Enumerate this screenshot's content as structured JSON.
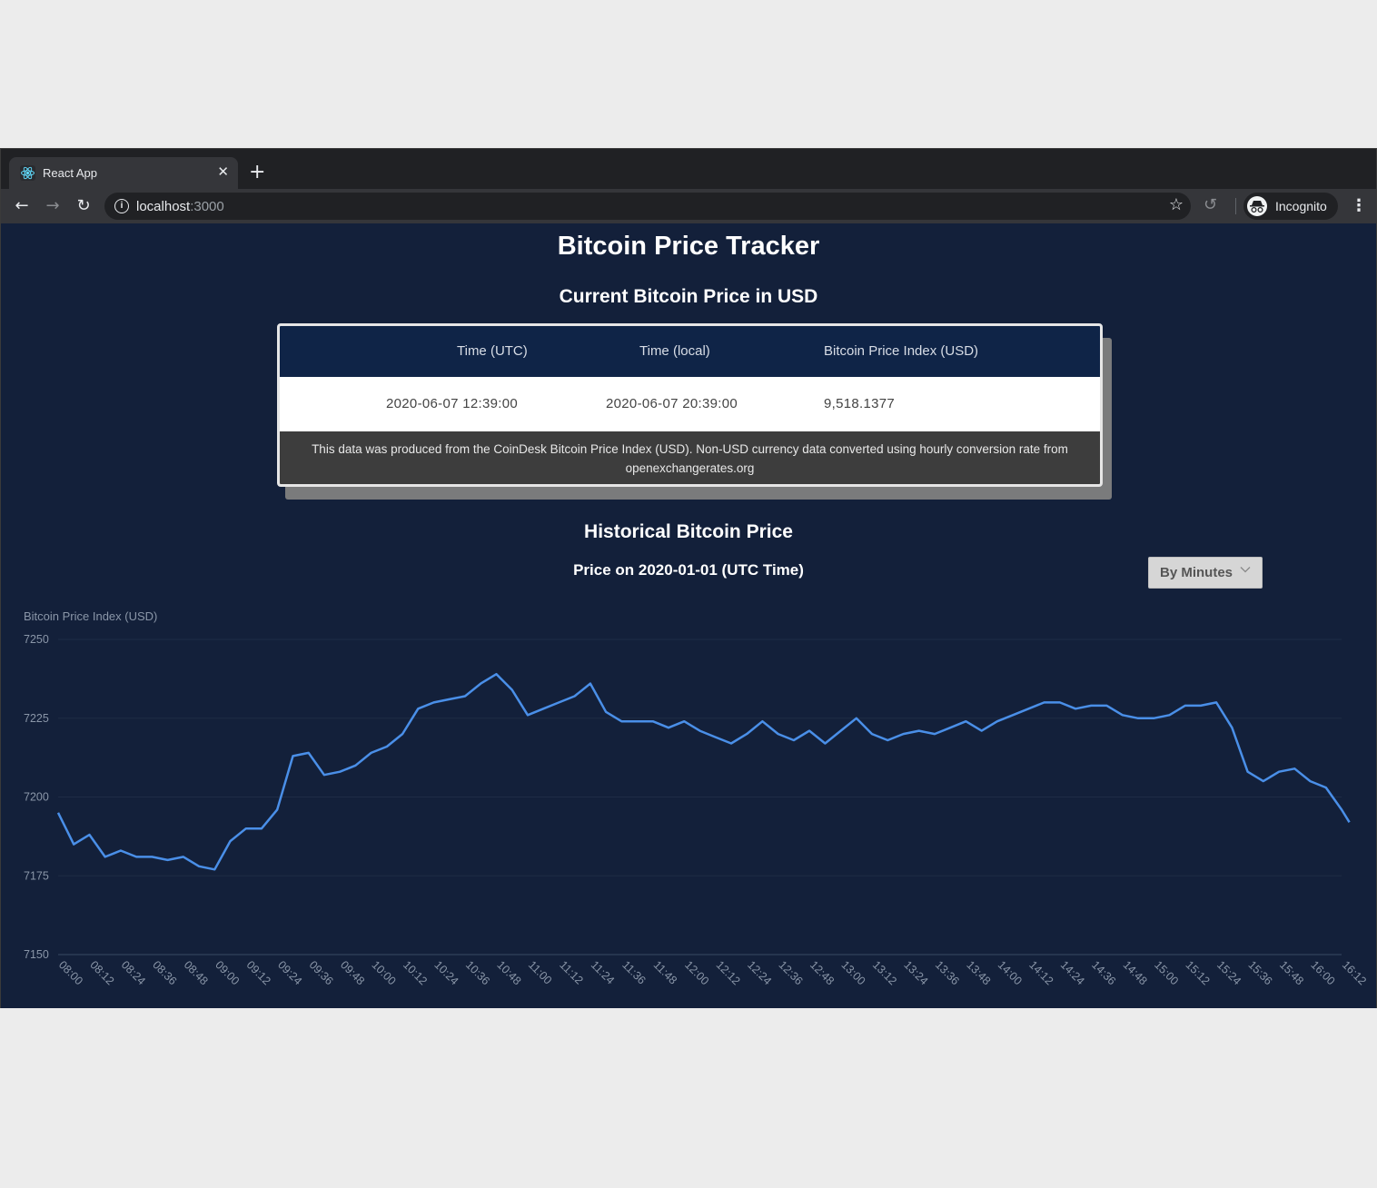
{
  "browser": {
    "tab_title": "React App",
    "url_host": "localhost",
    "url_port": ":3000",
    "profile_label": "Incognito",
    "icons": [
      "react-favicon",
      "close-icon",
      "plus-icon",
      "back-arrow-icon",
      "forward-arrow-icon",
      "reload-icon",
      "info-icon",
      "star-icon",
      "history-icon",
      "incognito-icon",
      "more-vert-icon"
    ]
  },
  "page": {
    "title": "Bitcoin Price Tracker",
    "current_section_title": "Current Bitcoin Price in USD",
    "table": {
      "headers": [
        "Time (UTC)",
        "Time (local)",
        "Bitcoin Price Index (USD)"
      ],
      "row": [
        "2020-06-07 12:39:00",
        "2020-06-07 20:39:00",
        "9,518.1377"
      ],
      "disclaimer": "This data was produced from the CoinDesk Bitcoin Price Index (USD). Non-USD currency data converted using hourly conversion rate from openexchangerates.org"
    },
    "historical_title": "Historical Bitcoin Price",
    "historical_subtitle": "Price on 2020-01-01 (UTC Time)",
    "granularity_select": {
      "selected": "By Minutes"
    }
  },
  "colors": {
    "background": "#13203a",
    "header": "#0f2447",
    "line": "#4a8fe8",
    "grid": "#1e2c45",
    "axis_text": "#8a96a8"
  },
  "chart_data": {
    "type": "line",
    "ylabel": "Bitcoin Price Index (USD)",
    "ylim": [
      7150,
      7250
    ],
    "yticks": [
      7150,
      7175,
      7200,
      7225,
      7250
    ],
    "xtick_labels": [
      "08:00",
      "08:12",
      "08:24",
      "08:36",
      "08:48",
      "09:00",
      "09:12",
      "09:24",
      "09:36",
      "09:48",
      "10:00",
      "10:12",
      "10:24",
      "10:36",
      "10:48",
      "11:00",
      "11:12",
      "11:24",
      "11:36",
      "11:48",
      "12:00",
      "12:12",
      "12:24",
      "12:36",
      "12:48",
      "13:00",
      "13:12",
      "13:24",
      "13:36",
      "13:48",
      "14:00",
      "14:12",
      "14:24",
      "14:36",
      "14:48",
      "15:00",
      "15:12",
      "15:24",
      "15:36",
      "15:48",
      "16:00",
      "16:12"
    ],
    "grid": "horizontal",
    "series": [
      {
        "x": [
          "08:00",
          "08:06",
          "08:12",
          "08:18",
          "08:24",
          "08:30",
          "08:36",
          "08:42",
          "08:48",
          "08:54",
          "09:00",
          "09:06",
          "09:12",
          "09:18",
          "09:24",
          "09:30",
          "09:36",
          "09:42",
          "09:48",
          "09:54",
          "10:00",
          "10:06",
          "10:12",
          "10:18",
          "10:24",
          "10:30",
          "10:36",
          "10:42",
          "10:48",
          "10:54",
          "11:00",
          "11:06",
          "11:12",
          "11:18",
          "11:24",
          "11:30",
          "11:36",
          "11:42",
          "11:48",
          "11:54",
          "12:00",
          "12:06",
          "12:12",
          "12:18",
          "12:24",
          "12:30",
          "12:36",
          "12:42",
          "12:48",
          "12:54",
          "13:00",
          "13:06",
          "13:12",
          "13:18",
          "13:24",
          "13:30",
          "13:36",
          "13:42",
          "13:48",
          "13:54",
          "14:00",
          "14:06",
          "14:12",
          "14:18",
          "14:24",
          "14:30",
          "14:36",
          "14:42",
          "14:48",
          "14:54",
          "15:00",
          "15:06",
          "15:12",
          "15:18",
          "15:24",
          "15:30",
          "15:36",
          "15:42",
          "15:48",
          "15:54",
          "16:00",
          "16:06",
          "16:12",
          "16:15"
        ],
        "values": [
          7195,
          7185,
          7188,
          7181,
          7183,
          7181,
          7181,
          7180,
          7181,
          7178,
          7177,
          7186,
          7190,
          7190,
          7196,
          7213,
          7214,
          7207,
          7208,
          7210,
          7214,
          7216,
          7220,
          7228,
          7230,
          7231,
          7232,
          7236,
          7239,
          7234,
          7226,
          7228,
          7230,
          7232,
          7236,
          7227,
          7224,
          7224,
          7224,
          7222,
          7224,
          7221,
          7219,
          7217,
          7220,
          7224,
          7220,
          7218,
          7221,
          7217,
          7221,
          7225,
          7220,
          7218,
          7220,
          7221,
          7220,
          7222,
          7224,
          7221,
          7224,
          7226,
          7228,
          7230,
          7230,
          7228,
          7229,
          7229,
          7226,
          7225,
          7225,
          7226,
          7229,
          7229,
          7230,
          7222,
          7208,
          7205,
          7208,
          7209,
          7205,
          7203,
          7196,
          7192
        ]
      }
    ]
  }
}
